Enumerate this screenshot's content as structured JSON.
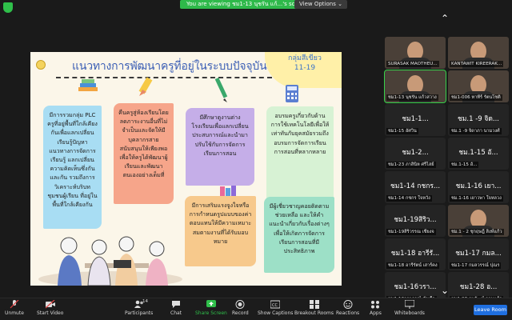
{
  "status_bar": {
    "viewing_text": "You are viewing ชม1-13 นุชรัน แก้...'s screen",
    "view_options_label": "View Options ⌄"
  },
  "slide": {
    "title": "แนวทางการพัฒนาครูที่อยู่ในระบบปัจจุบัน",
    "group_label": "กลุ่มสีเขียว",
    "group_range": "11-19",
    "cards": [
      {
        "text": "มีการรวมกลุ่ม PLC ครูที่อยู่พื้นที่ใกล้เคียงกันเพื่อแลกเปลี่ยนเรียนรู้ปัญหา แนวทางการจัดการเรียนรู้ แลกเปลี่ยนความคิดเห็นซึ่งกันและกัน รวมถึงการวิเคราะห์บริบทชุมชนผู้เรียน ที่อยู่ในพื้นที่ใกล้เคียงกัน"
      },
      {
        "text": "คืนครูสู่ห้องเรียนโดยลดภาระงานอื่นที่ไม่จำเป็นและจัดให้มีบุคลากรสายสนับสนุนให้เพียงพอ เพื่อให้ครูได้พัฒนาผู้เรียนและพัฒนาตนเองอย่างเต็มที่"
      },
      {
        "text": "มีศึกษาดูงานต่างโรงเรียนเพื่อแลกเปลี่ยนประสบการณ์และนำมาปรับใช้กับการจัดการเรียนการสอน"
      },
      {
        "text": "อบรมครูเกี่ยวกับด้านการใช้เทคโนโลยีเพื่อให้เท่าทันกับยุคสมัยรวมถึงอบรมการจัดการเรียนการสอนที่หลากหลาย"
      },
      {
        "text": "มีการเสริมแรงจูงใจหรือการกำหนดรูปแบบของค่าตอบแทนให้มีความเหมาะสมตามงานที่ได้รับมอบหมาย"
      },
      {
        "text": "มีผู้เชี่ยวชาญคอยติดตาม ช่วยเหลือ และให้คำแนะนำเกี่ยวกับเรื่องต่างๆเพื่อให้เกิดการจัดการเรียนการสอนที่มีประสิทธิภาพ"
      }
    ]
  },
  "participants": [
    {
      "name": "",
      "label": "SURASAK MAOTHEU...",
      "video": true,
      "active": false
    },
    {
      "name": "",
      "label": "KANTAWIT KIREERAK...",
      "video": true,
      "active": false
    },
    {
      "name": "",
      "label": "ชม1-13 นุชรัน แก้วสวาง",
      "video": true,
      "active": true
    },
    {
      "name": "",
      "label": "ชม1-006 ทาทีร์ รัตนโชติ",
      "video": true,
      "active": false
    },
    {
      "name": "ชม1-1...",
      "label": "ชม1-15 อัศวิน",
      "video": false,
      "active": false
    },
    {
      "name": "ชม.1 -9 จิด...",
      "label": "ชม.1 -9 จิดาภา นามวงศ์",
      "video": false,
      "active": false
    },
    {
      "name": "ชม1-2...",
      "label": "ชม1-23 ภาสินิห ศรีไสย์",
      "video": false,
      "active": false
    },
    {
      "name": "ชม.1-15 อั...",
      "label": "ชม.1-15 อั...",
      "video": false,
      "active": false
    },
    {
      "name": "ชม1-14 กชกร...",
      "label": "ชม1-14 กชกร ใจหวัง",
      "video": false,
      "active": false
    },
    {
      "name": "ชม.1-16 เยา...",
      "label": "ชม.1-16 เยาวพา ใจหลวง",
      "video": false,
      "active": false
    },
    {
      "name": "ชม1-19สิริว...",
      "label": "ชม1-19สิริวรรณ เชียงจ",
      "video": false,
      "active": false
    },
    {
      "name": "",
      "label": "ชม.1 - 2 ชุกฤษฎิ์ สิงห์แก้ว",
      "video": true,
      "active": false
    },
    {
      "name": "ชม1-18 อารีรั...",
      "label": "ชม1-18 อารีรัตน์ เสาร์คง",
      "video": false,
      "active": false
    },
    {
      "name": "ชม1-17 กมล...",
      "label": "ชม1-17 กมลวรรณ์ ปุณร",
      "video": false,
      "active": false
    },
    {
      "name": "ชม1-16วรา...",
      "label": "ชม1-16วราภรณ์ คำเอื้อ",
      "video": false,
      "active": false
    },
    {
      "name": "ชม1-28 อ...",
      "label": "ชม1-28 อนวัฒน์ กานแก้ว",
      "video": false,
      "active": false
    }
  ],
  "toolbar": {
    "unmute": "Unmute",
    "start_video": "Start Video",
    "participants": "Participants",
    "participants_count": "14",
    "chat": "Chat",
    "share_screen": "Share Screen",
    "record": "Record",
    "show_captions": "Show Captions",
    "breakout_rooms": "Breakout Rooms",
    "reactions": "Reactions",
    "apps": "Apps",
    "whiteboards": "Whiteboards",
    "leave": "Leave Room"
  },
  "colors": {
    "accent_green": "#2fbf4a",
    "leave_blue": "#1f6fe0",
    "title_blue": "#3c5fb5"
  }
}
